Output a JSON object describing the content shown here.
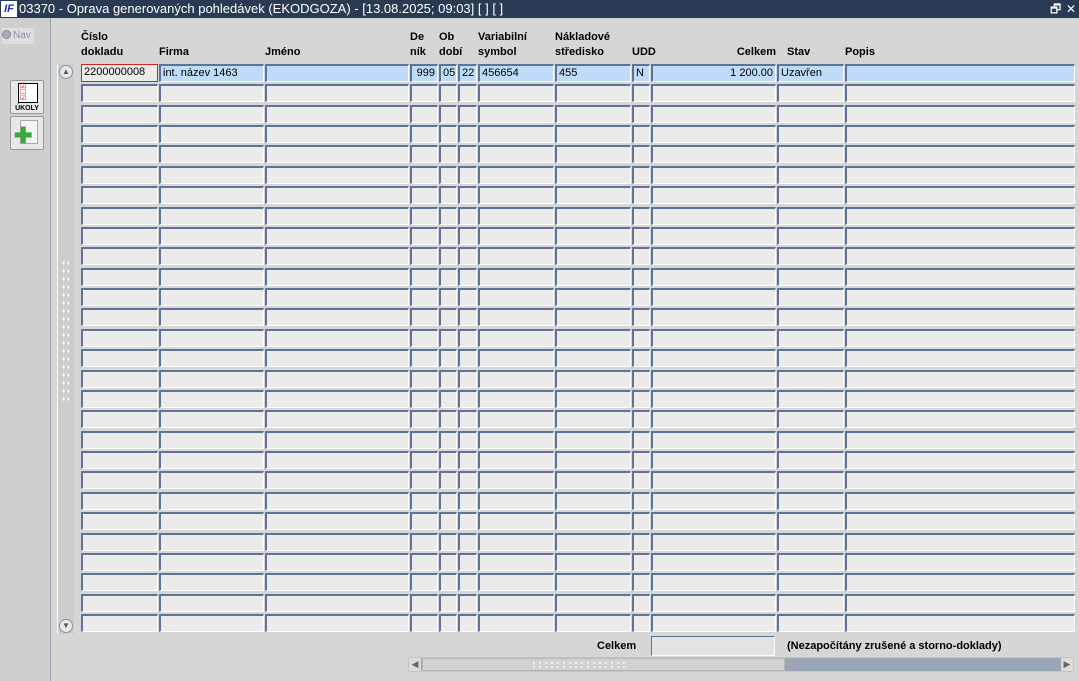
{
  "window": {
    "logo": "IF",
    "title": "03370 - Oprava generovaných pohledávek (EKODGOZA) - [13.08.2025; 09:03]  [ ]  [ ]",
    "restore_icon": "restore-icon",
    "close_icon": "close-icon",
    "restore_glyph": "🗗",
    "close_glyph": "✕"
  },
  "sidebar": {
    "nav_label": "Nav",
    "tasks_label": "ÚKOLY",
    "tasks_icon": "task-list-icon",
    "new_icon": "new-document-icon"
  },
  "columns": [
    {
      "key": "cislo",
      "line1": "Číslo",
      "line2": "dokladu"
    },
    {
      "key": "firma",
      "line1": "",
      "line2": "Firma"
    },
    {
      "key": "jmeno",
      "line1": "",
      "line2": "Jméno"
    },
    {
      "key": "denik",
      "line1": "De",
      "line2": "ník"
    },
    {
      "key": "obdobi",
      "line1": "Ob",
      "line2": "dobí"
    },
    {
      "key": "rok",
      "line1": "",
      "line2": ""
    },
    {
      "key": "vs",
      "line1": "Variabilní",
      "line2": "symbol"
    },
    {
      "key": "ns",
      "line1": "Nákladové",
      "line2": "středisko"
    },
    {
      "key": "udd",
      "line1": "",
      "line2": "UDD"
    },
    {
      "key": "celkem",
      "line1": "",
      "line2": "Celkem"
    },
    {
      "key": "stav",
      "line1": "",
      "line2": "Stav"
    },
    {
      "key": "popis",
      "line1": "",
      "line2": "Popis"
    }
  ],
  "rows": [
    {
      "cislo": "2200000008",
      "firma": "int. název 1463",
      "jmeno": "",
      "denik": "999",
      "obdobi": "05",
      "rok": "22",
      "vs": "456654",
      "ns": "455",
      "udd": "N",
      "celkem": "1 200.00",
      "stav": "Uzavřen",
      "popis": ""
    }
  ],
  "row_count": 28,
  "footer": {
    "total_label": "Celkem",
    "total_value": "",
    "note": "(Nezapočítány zrušené a storno-doklady)"
  }
}
